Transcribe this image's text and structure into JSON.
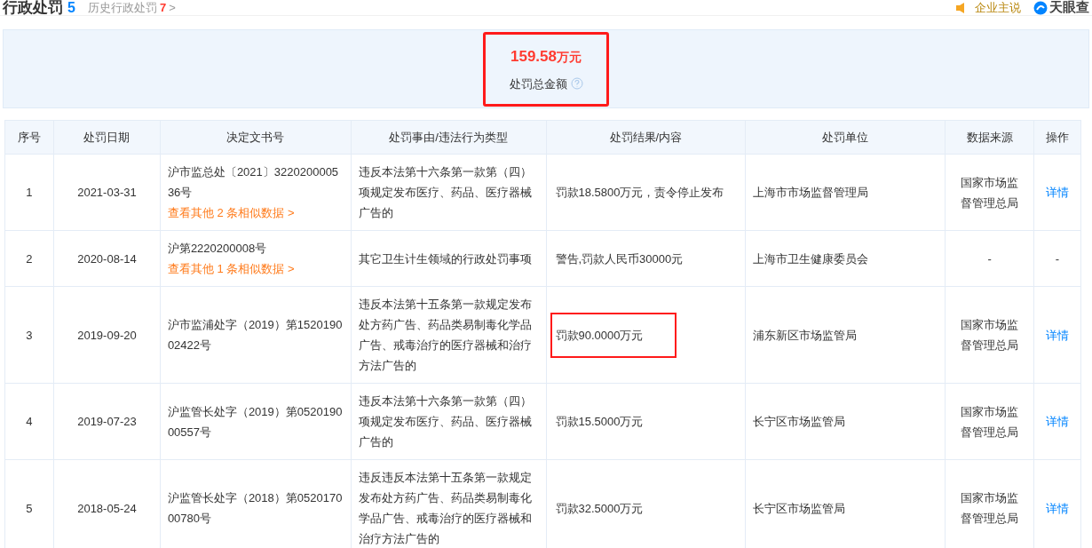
{
  "header": {
    "title": "行政处罚",
    "count": "5",
    "history_label": "历史行政处罚",
    "history_count": "7",
    "history_arrow": ">",
    "company_says": "企业主说",
    "brand": "天眼查"
  },
  "summary": {
    "amount": "159.58",
    "unit": "万元",
    "label": "处罚总金额",
    "highlighted": true
  },
  "table": {
    "columns": [
      "序号",
      "处罚日期",
      "决定文书号",
      "处罚事由/违法行为类型",
      "处罚结果/内容",
      "处罚单位",
      "数据来源",
      "操作"
    ],
    "rows": [
      {
        "index": "1",
        "date": "2021-03-31",
        "doc": "沪市监总处〔2021〕322020000536号",
        "similar": "查看其他 2 条相似数据 >",
        "reason": "违反本法第十六条第一款第（四）项规定发布医疗、药品、医疗器械广告的",
        "result": "罚款18.5800万元，责令停止发布",
        "highlighted": false,
        "unit": "上海市市场监督管理局",
        "source": "国家市场监督管理总局",
        "action": {
          "kind": "link",
          "text": "详情"
        }
      },
      {
        "index": "2",
        "date": "2020-08-14",
        "doc": "沪第2220200008号",
        "similar": "查看其他 1 条相似数据 >",
        "reason": "其它卫生计生领域的行政处罚事项",
        "result": "警告,罚款人民币30000元",
        "highlighted": false,
        "unit": "上海市卫生健康委员会",
        "source": "-",
        "action": {
          "kind": "plain",
          "text": "-"
        }
      },
      {
        "index": "3",
        "date": "2019-09-20",
        "doc": "沪市监浦处字（2019）第152019002422号",
        "reason": "违反本法第十五条第一款规定发布处方药广告、药品类易制毒化学品广告、戒毒治疗的医疗器械和治疗方法广告的",
        "result": "罚款90.0000万元",
        "highlighted": true,
        "unit": "浦东新区市场监管局",
        "source": "国家市场监督管理总局",
        "action": {
          "kind": "link",
          "text": "详情"
        }
      },
      {
        "index": "4",
        "date": "2019-07-23",
        "doc": "沪监管长处字（2019）第052019000557号",
        "reason": "违反本法第十六条第一款第（四）项规定发布医疗、药品、医疗器械广告的",
        "result": "罚款15.5000万元",
        "highlighted": false,
        "unit": "长宁区市场监管局",
        "source": "国家市场监督管理总局",
        "action": {
          "kind": "link",
          "text": "详情"
        }
      },
      {
        "index": "5",
        "date": "2018-05-24",
        "doc": "沪监管长处字（2018）第052017000780号",
        "reason": "违反违反本法第十五条第一款规定发布处方药广告、药品类易制毒化学品广告、戒毒治疗的医疗器械和治疗方法广告的",
        "result": "罚款32.5000万元",
        "highlighted": false,
        "unit": "长宁区市场监管局",
        "source": "国家市场监督管理总局",
        "action": {
          "kind": "link",
          "text": "详情"
        }
      }
    ]
  }
}
